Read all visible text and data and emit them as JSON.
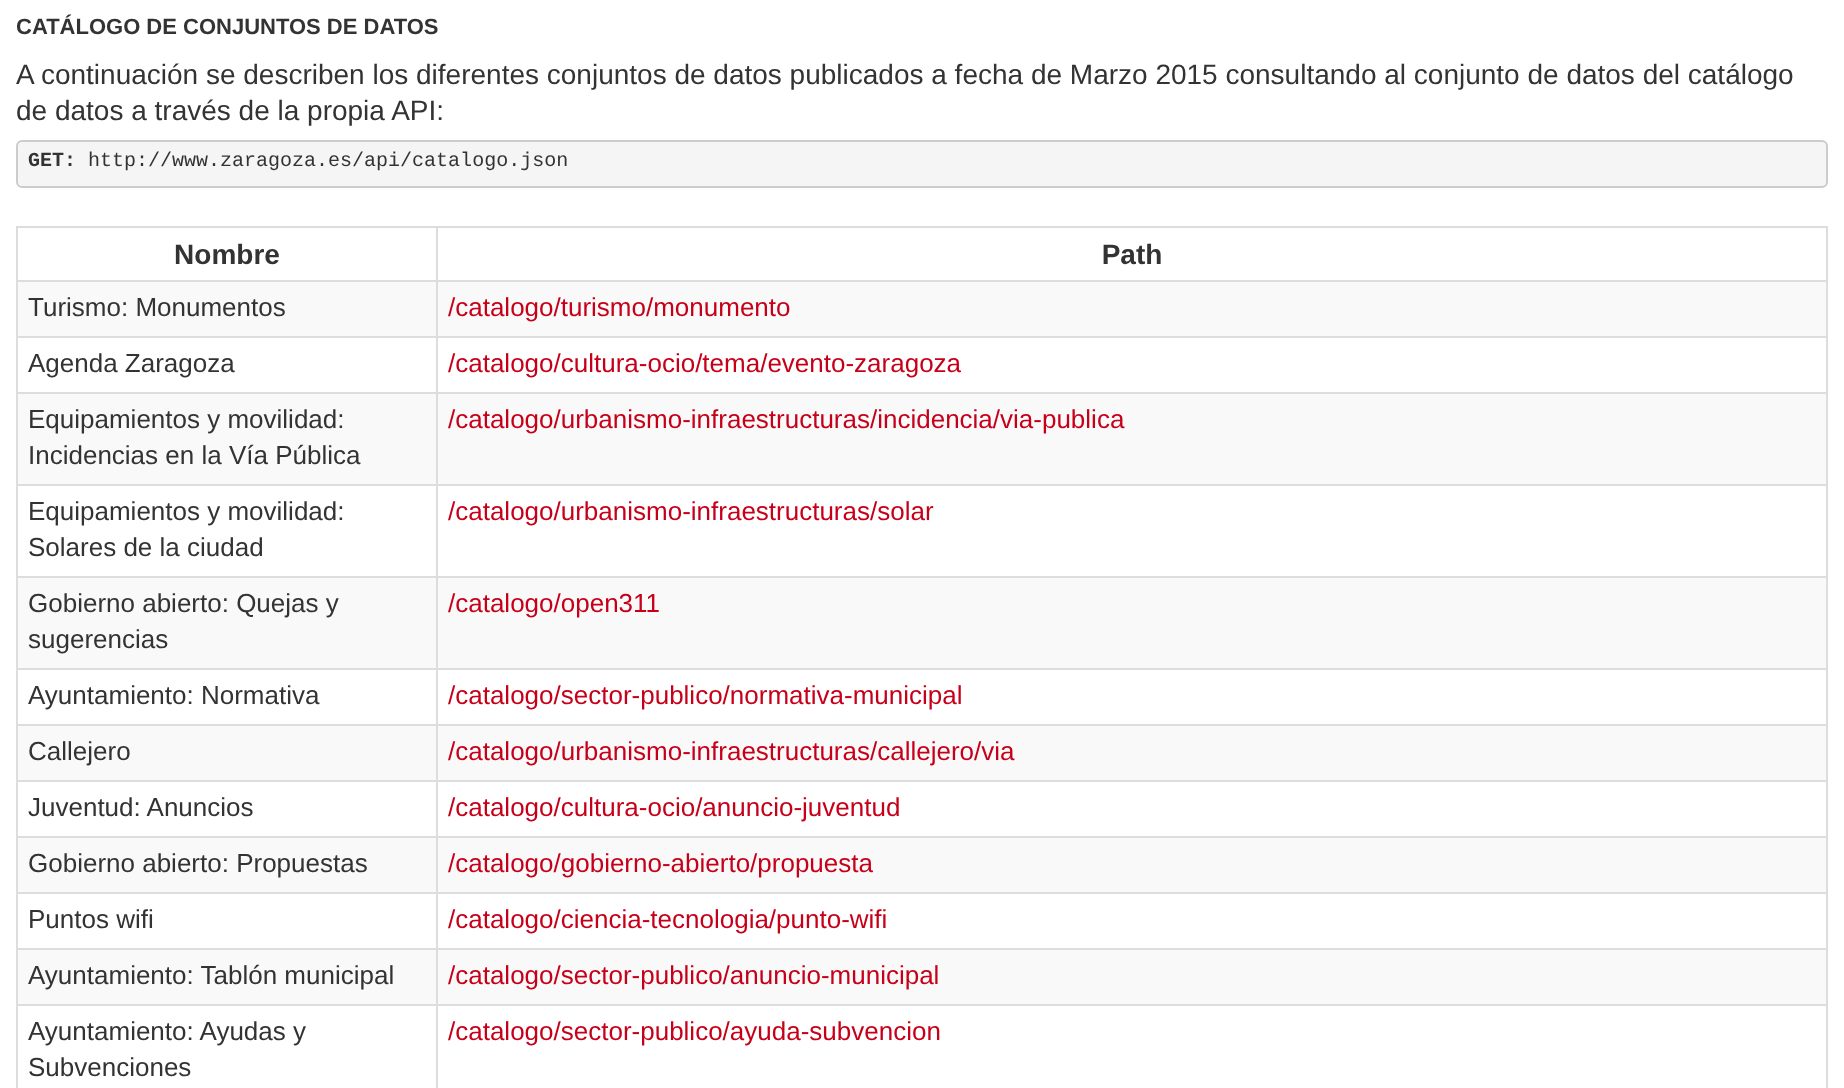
{
  "heading": "CATÁLOGO DE CONJUNTOS DE DATOS",
  "intro": "A continuación se describen los diferentes conjuntos de datos publicados a fecha de Marzo 2015 consultando al conjunto de datos del catálogo de datos a través de la propia API:",
  "code": {
    "method": "GET:",
    "url": "http://www.zaragoza.es/api/catalogo.json"
  },
  "table": {
    "columns": [
      "Nombre",
      "Path"
    ],
    "rows": [
      {
        "name": "Turismo: Monumentos",
        "path": "/catalogo/turismo/monumento"
      },
      {
        "name": "Agenda Zaragoza",
        "path": "/catalogo/cultura-ocio/tema/evento-zaragoza"
      },
      {
        "name": "Equipamientos y movilidad: Incidencias en la Vía Pública",
        "path": "/catalogo/urbanismo-infraestructuras/incidencia/via-publica"
      },
      {
        "name": "Equipamientos y movilidad: Solares de la ciudad",
        "path": "/catalogo/urbanismo-infraestructuras/solar"
      },
      {
        "name": "Gobierno abierto: Quejas y sugerencias",
        "path": "/catalogo/open311"
      },
      {
        "name": "Ayuntamiento: Normativa",
        "path": "/catalogo/sector-publico/normativa-municipal"
      },
      {
        "name": "Callejero",
        "path": "/catalogo/urbanismo-infraestructuras/callejero/via"
      },
      {
        "name": "Juventud: Anuncios",
        "path": "/catalogo/cultura-ocio/anuncio-juventud"
      },
      {
        "name": "Gobierno abierto: Propuestas",
        "path": "/catalogo/gobierno-abierto/propuesta"
      },
      {
        "name": "Puntos wifi",
        "path": "/catalogo/ciencia-tecnologia/punto-wifi"
      },
      {
        "name": "Ayuntamiento: Tablón municipal",
        "path": "/catalogo/sector-publico/anuncio-municipal"
      },
      {
        "name": "Ayuntamiento: Ayudas y Subvenciones",
        "path": "/catalogo/sector-publico/ayuda-subvencion"
      }
    ]
  }
}
